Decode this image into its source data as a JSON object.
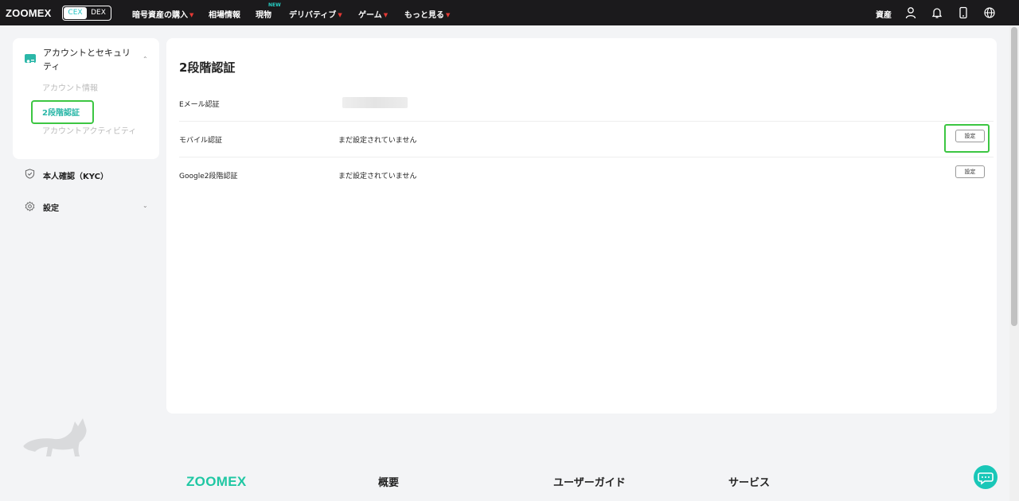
{
  "nav": {
    "logo": "ZOOMEX",
    "switch": {
      "cex": "CEX",
      "dex": "DEX"
    },
    "menu": [
      {
        "label": "暗号資産の購入",
        "caret": true
      },
      {
        "label": "相場情報",
        "caret": false
      },
      {
        "label": "現物",
        "caret": false
      },
      {
        "label": "デリバティブ",
        "caret": true
      },
      {
        "label": "ゲーム",
        "caret": true
      },
      {
        "label": "もっと見る",
        "caret": true
      }
    ],
    "new_badge": "NEW",
    "assets": "資産",
    "icons": [
      "user-icon",
      "bell-icon",
      "phone-icon",
      "globe-icon"
    ]
  },
  "sidebar": {
    "section_title": "アカウントとセキュリティ",
    "items": [
      {
        "label": "アカウント情報"
      },
      {
        "label": "2段階認証"
      },
      {
        "label": "アカウントアクティビティ"
      }
    ],
    "kyc": "本人確認（KYC）",
    "settings": "設定"
  },
  "main": {
    "title": "2段階認証",
    "rows": [
      {
        "label": "Eメール認証",
        "value": ""
      },
      {
        "label": "モバイル認証",
        "value": "まだ設定されていません",
        "button": "設定"
      },
      {
        "label": "Google2段階認証",
        "value": "まだ設定されていません",
        "button": "設定"
      }
    ]
  },
  "footer": {
    "logo": "ZOOMEX",
    "columns": [
      "概要",
      "ユーザーガイド",
      "サービス"
    ]
  },
  "colors": {
    "accent": "#2bb7a8",
    "highlight": "#3cc642",
    "nav_bg": "#1b1a1c",
    "caret": "#e53935"
  }
}
